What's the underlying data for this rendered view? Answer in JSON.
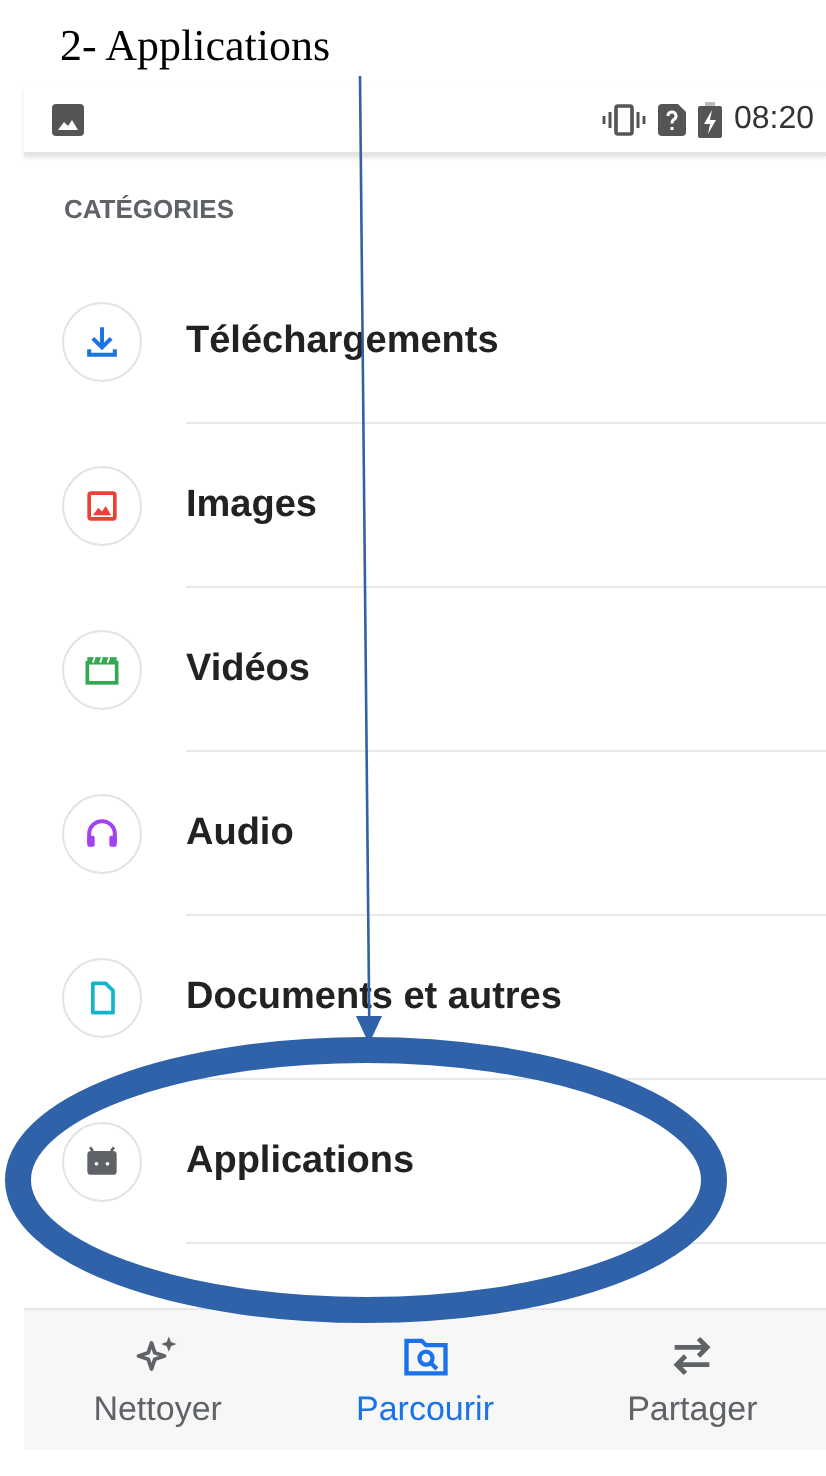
{
  "annotation": {
    "title": "2- Applications"
  },
  "status_bar": {
    "time": "08:20"
  },
  "categories": {
    "heading": "CATÉGORIES",
    "items": [
      {
        "label": "Téléchargements",
        "kind": "download",
        "color": "#1a73e8"
      },
      {
        "label": "Images",
        "kind": "image",
        "color": "#ea4335"
      },
      {
        "label": "Vidéos",
        "kind": "video",
        "color": "#34a853"
      },
      {
        "label": "Audio",
        "kind": "audio",
        "color": "#a142f4"
      },
      {
        "label": "Documents et autres",
        "kind": "document",
        "color": "#12b5cb"
      },
      {
        "label": "Applications",
        "kind": "apps",
        "color": "#5f6368"
      }
    ]
  },
  "bottom_nav": [
    {
      "label": "Nettoyer",
      "kind": "clean",
      "selected": false
    },
    {
      "label": "Parcourir",
      "kind": "browse",
      "selected": true
    },
    {
      "label": "Partager",
      "kind": "share",
      "selected": false
    }
  ]
}
